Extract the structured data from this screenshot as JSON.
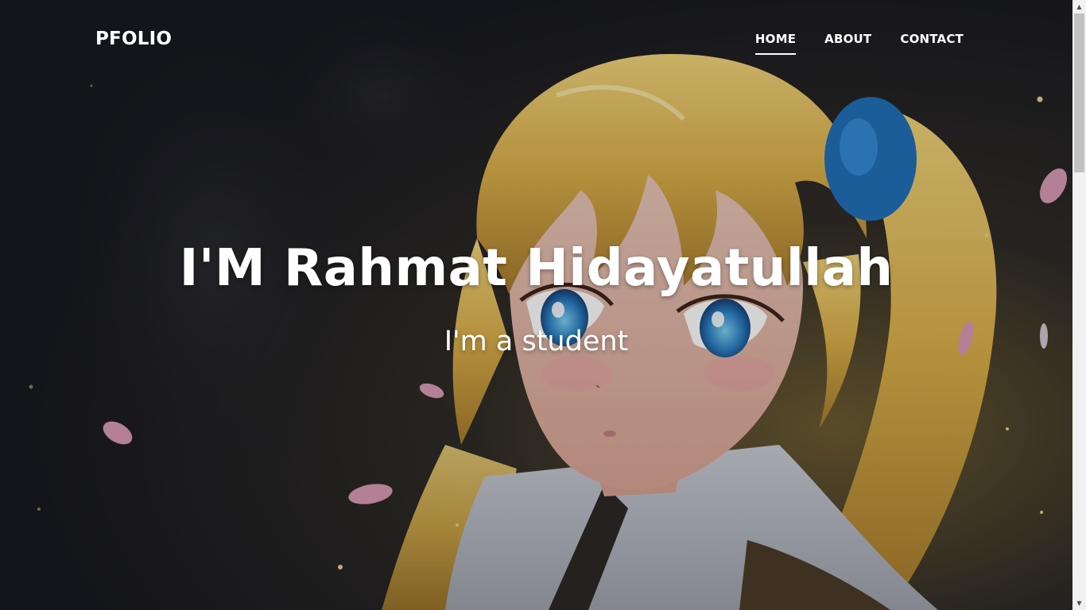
{
  "navbar": {
    "brand": "PFOLIO",
    "links": [
      {
        "label": "HOME",
        "active": true
      },
      {
        "label": "ABOUT",
        "active": false
      },
      {
        "label": "CONTACT",
        "active": false
      }
    ]
  },
  "hero": {
    "title": "I'M Rahmat Hidayatullah",
    "subtitle": "I'm a student",
    "background": "anime-girl-illustration"
  },
  "colors": {
    "text": "#ffffff",
    "background": "#15161b",
    "hair": "#e8c25a",
    "scrunchie": "#1f6fb8",
    "petal": "#d89ab4"
  }
}
